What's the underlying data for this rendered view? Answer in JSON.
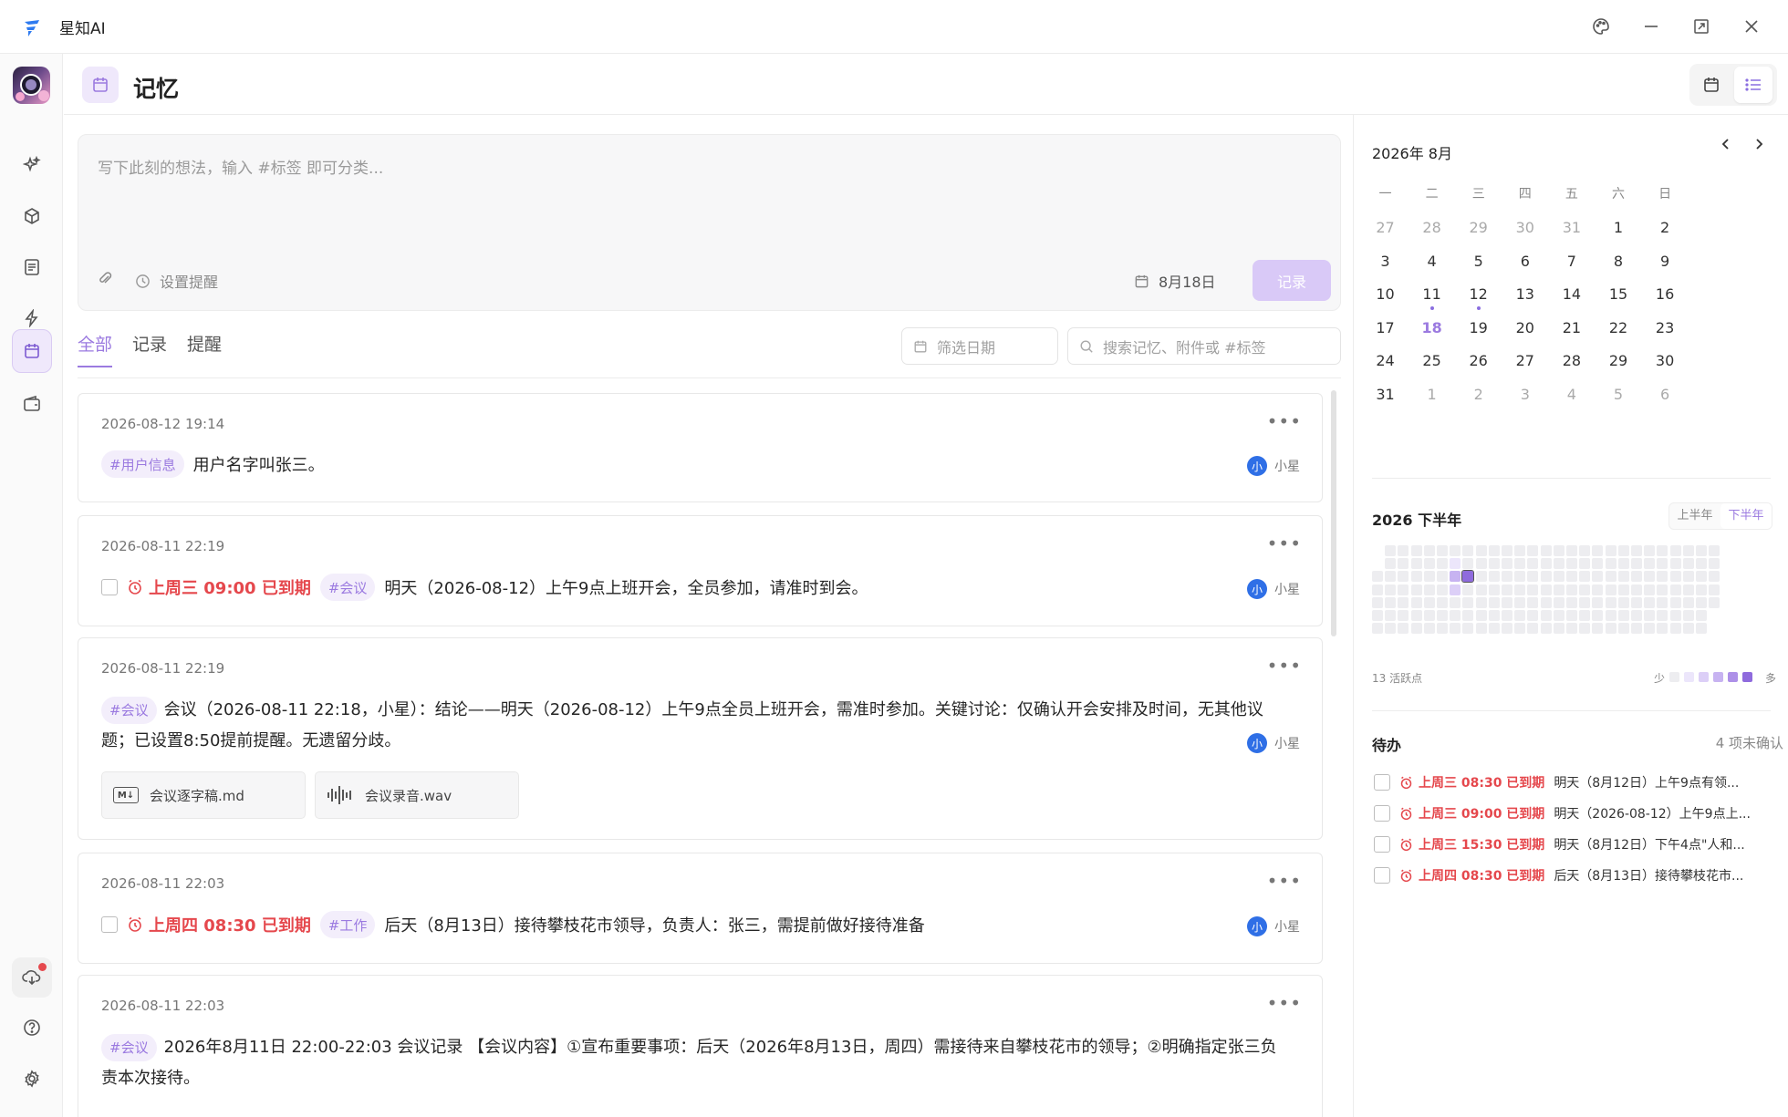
{
  "app": {
    "title": "星知AI"
  },
  "header": {
    "title": "记忆"
  },
  "composer": {
    "placeholder": "写下此刻的想法，输入 #标签 即可分类...",
    "remind_label": "设置提醒",
    "date_label": "8月18日",
    "submit_label": "记录"
  },
  "tabs": [
    {
      "label": "全部",
      "active": true
    },
    {
      "label": "记录",
      "active": false
    },
    {
      "label": "提醒",
      "active": false
    }
  ],
  "filters": {
    "date_placeholder": "筛选日期",
    "search_placeholder": "搜索记忆、附件或 #标签"
  },
  "feed": [
    {
      "time": "2026-08-12 19:14",
      "tag": "#用户信息",
      "text": "用户名字叫张三。",
      "author": "小星",
      "author_initial": "小"
    },
    {
      "time": "2026-08-11 22:19",
      "overdue": "上周三 09:00 已到期",
      "tag": "#会议",
      "text": "明天（2026-08-12）上午9点上班开会，全员参加，请准时到会。",
      "author": "小星",
      "author_initial": "小"
    },
    {
      "time": "2026-08-11 22:19",
      "tag": "#会议",
      "text": "会议（2026-08-11 22:18，小星）：结论——明天（2026-08-12）上午9点全员上班开会，需准时参加。关键讨论：仅确认开会安排及时间，无其他议题；已设置8:50提前提醒。无遗留分歧。",
      "author": "小星",
      "author_initial": "小",
      "attachments": [
        {
          "icon": "markdown-icon",
          "name": "会议逐字稿.md"
        },
        {
          "icon": "audio-wave-icon",
          "name": "会议录音.wav"
        }
      ]
    },
    {
      "time": "2026-08-11 22:03",
      "overdue": "上周四 08:30 已到期",
      "tag": "#工作",
      "text": "后天（8月13日）接待攀枝花市领导，负责人：张三，需提前做好接待准备",
      "author": "小星",
      "author_initial": "小"
    },
    {
      "time": "2026-08-11 22:03",
      "tag": "#会议",
      "text": "2026年8月11日 22:00-22:03 会议记录 【会议内容】①宣布重要事项：后天（2026年8月13日，周四）需接待来自攀枝花市的领导；②明确指定张三负责本次接待。",
      "author": "小星",
      "author_initial": "小"
    }
  ],
  "calendar": {
    "title": "2026年 8月",
    "weekdays": [
      "一",
      "二",
      "三",
      "四",
      "五",
      "六",
      "日"
    ],
    "weeks": [
      [
        "27",
        "28",
        "29",
        "30",
        "31",
        "1",
        "2"
      ],
      [
        "3",
        "4",
        "5",
        "6",
        "7",
        "8",
        "9"
      ],
      [
        "10",
        "11",
        "12",
        "13",
        "14",
        "15",
        "16"
      ],
      [
        "17",
        "18",
        "19",
        "20",
        "21",
        "22",
        "23"
      ],
      [
        "24",
        "25",
        "26",
        "27",
        "28",
        "29",
        "30"
      ],
      [
        "31",
        "1",
        "2",
        "3",
        "4",
        "5",
        "6"
      ]
    ],
    "today": "18",
    "marked_days": [
      "11",
      "12"
    ]
  },
  "heatmap": {
    "title": "2026 下半年",
    "toggle": [
      "上半年",
      "下半年"
    ],
    "active_toggle": "下半年",
    "caption": "13 活跃点",
    "legend_less": "少",
    "legend_more": "多",
    "colors": [
      "#ededf0",
      "#ece6fb",
      "#dccff7",
      "#c7b3f1",
      "#ad90e8",
      "#8f6bdd"
    ]
  },
  "todos": {
    "title": "待办",
    "count": "4 项未确认",
    "items": [
      {
        "overdue": "上周三 08:30 已到期",
        "text": "明天（8月12日）上午9点有领..."
      },
      {
        "overdue": "上周三 09:00 已到期",
        "text": "明天（2026-08-12）上午9点上..."
      },
      {
        "overdue": "上周三 15:30 已到期",
        "text": "明天（8月12日）下午4点\"人和..."
      },
      {
        "overdue": "上周四 08:30 已到期",
        "text": "后天（8月13日）接待攀枝花市..."
      }
    ]
  },
  "accent_color": "#9b7ae0",
  "overdue_color": "#e5484d"
}
